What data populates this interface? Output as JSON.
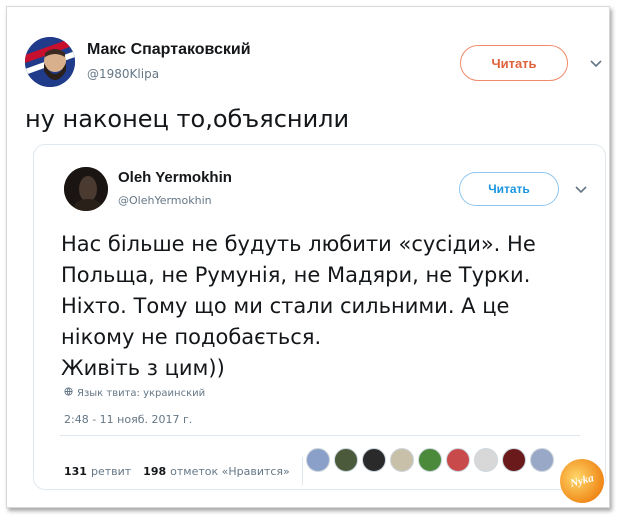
{
  "outer_tweet": {
    "author_name": "Макс Спартаковский",
    "handle": "@1980Klipa",
    "follow_label": "Читать",
    "text": "ну наконец то,объяснили"
  },
  "quoted_tweet": {
    "author_name": "Oleh Yermokhin",
    "handle": "@OlehYermokhin",
    "follow_label": "Читать",
    "text_lines": [
      "Нас більше не будуть любити «сусіди». Не",
      "Польща, не Румунія, не Мадяри, не Турки.",
      "Ніхто. Тому що ми стали сильними. А це",
      "нікому не подобається.",
      "Живіть з цим))"
    ],
    "language_note": "Язык твита: украинский",
    "timestamp": "2:48 - 11 нояб. 2017 г.",
    "retweets_count": "131",
    "retweets_label": "ретвит",
    "likes_count": "198",
    "likes_label": "отметок «Нравится»",
    "liker_avatar_colors": [
      "#8aa0c8",
      "#4a5a3a",
      "#2a2a2a",
      "#c8c0a8",
      "#4a8a3a",
      "#c84a4a",
      "#d8d8d8",
      "#6a1a1a",
      "#9aa8c8"
    ]
  },
  "watermark": {
    "text": "Nyka"
  },
  "colors": {
    "follow_outer": "#e0623c",
    "follow_quote": "#1b95e0",
    "secondary_text": "#657786"
  }
}
